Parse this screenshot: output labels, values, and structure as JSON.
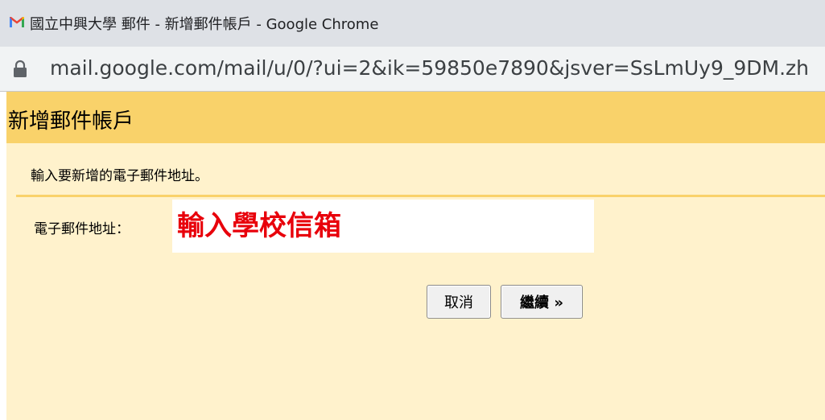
{
  "window": {
    "title": "國立中興大學 郵件 - 新增郵件帳戶 - Google Chrome",
    "app_icon": "gmail-icon"
  },
  "address_bar": {
    "url": "mail.google.com/mail/u/0/?ui=2&ik=59850e7890&jsver=SsLmUy9_9DM.zh",
    "security_icon": "lock-icon"
  },
  "dialog": {
    "title": "新增郵件帳戶",
    "instruction": "輸入要新增的電子郵件地址。",
    "email_label": "電子郵件地址：",
    "email_placeholder": "輸入學校信箱",
    "email_value": "",
    "cancel_label": "取消",
    "continue_label": "繼續 »"
  },
  "colors": {
    "header_bg": "#f9d26a",
    "page_bg": "#fff2cc",
    "placeholder_color": "#e8000b"
  }
}
